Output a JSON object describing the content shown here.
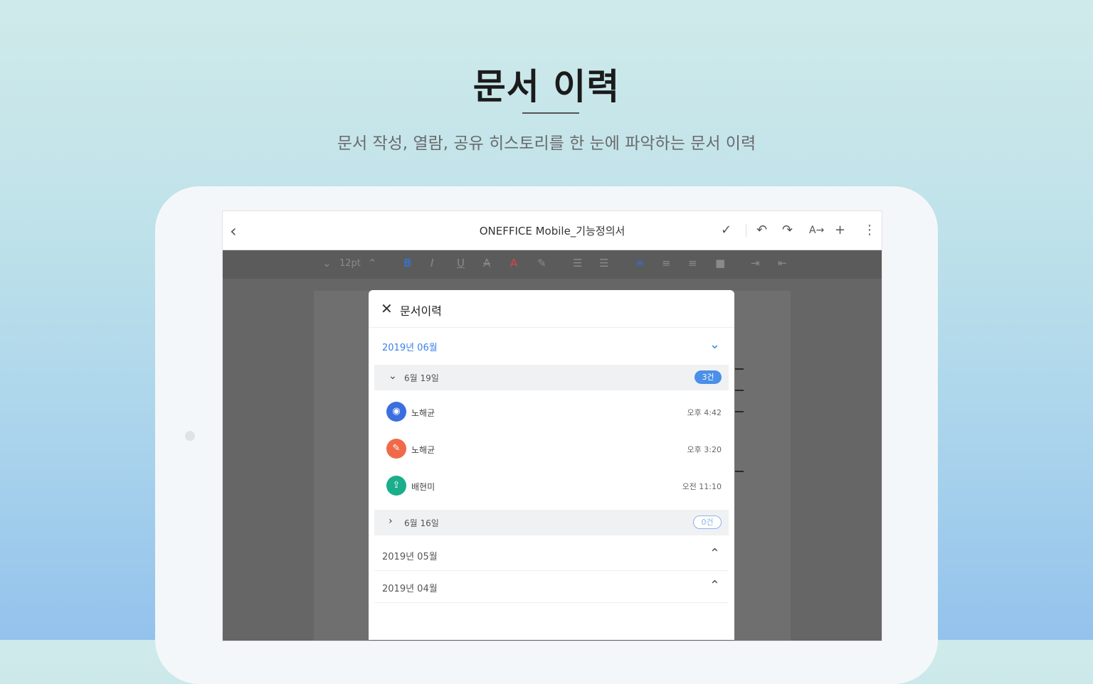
{
  "hero": {
    "title": "문서 이력",
    "subtitle": "문서 작성, 열람, 공유 히스토리를 한 눈에 파악하는 문서 이력"
  },
  "appbar": {
    "title": "ONEFFICE Mobile_기능정의서",
    "icons": [
      "back-icon",
      "check-icon",
      "undo-icon",
      "redo-icon",
      "text-format-icon",
      "plus-icon",
      "more-icon"
    ]
  },
  "toolbar": {
    "font_size": "12pt",
    "icons": [
      "font-size-down-icon",
      "font-size-up-icon",
      "bold-icon",
      "italic-icon",
      "underline-icon",
      "strikethrough-icon",
      "text-color-icon",
      "highlight-icon",
      "bullet-list-icon",
      "numbered-list-icon",
      "align-left-icon",
      "align-center-icon",
      "align-right-icon",
      "justify-icon",
      "indent-icon",
      "outdent-icon"
    ]
  },
  "history_panel": {
    "title": "문서이력",
    "months": [
      {
        "label": "2019년 06월",
        "expanded": true,
        "days": [
          {
            "label": "6월 19일",
            "badge": "3건",
            "expanded": true,
            "entries": [
              {
                "name": "노해균",
                "time": "오후 4:42",
                "color": "#3b6fe0",
                "icon": "eye-icon"
              },
              {
                "name": "노해균",
                "time": "오후 3:20",
                "color": "#f06a4a",
                "icon": "edit-icon"
              },
              {
                "name": "배현미",
                "time": "오전 11:10",
                "color": "#1aae8a",
                "icon": "share-icon"
              }
            ]
          },
          {
            "label": "6월 16일",
            "badge": "0건",
            "expanded": false
          }
        ]
      },
      {
        "label": "2019년 05월",
        "expanded": false
      },
      {
        "label": "2019년 04월",
        "expanded": false
      }
    ]
  },
  "colors": {
    "accent": "#3a82e8",
    "panel_bg": "#ffffff",
    "screen_bg": "#666666"
  }
}
